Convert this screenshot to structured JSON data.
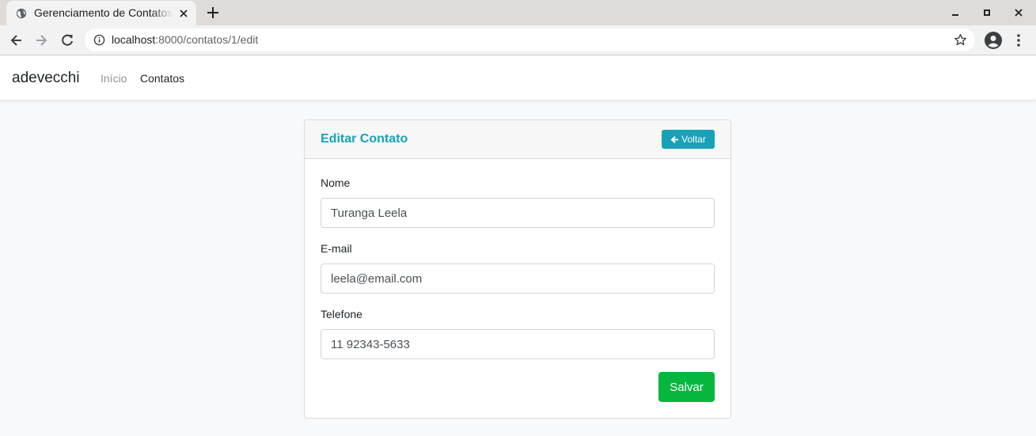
{
  "browser": {
    "tab_title": "Gerenciamento de Contatos",
    "url_host": "localhost",
    "url_path": ":8000/contatos/1/edit"
  },
  "navbar": {
    "brand": "adevecchi",
    "links": [
      {
        "label": "Início",
        "active": false
      },
      {
        "label": "Contatos",
        "active": true
      }
    ]
  },
  "card": {
    "title": "Editar Contato",
    "back_label": "Voltar",
    "fields": {
      "nome": {
        "label": "Nome",
        "value": "Turanga Leela"
      },
      "email": {
        "label": "E-mail",
        "value": "leela@email.com"
      },
      "telefone": {
        "label": "Telefone",
        "value": "11 92343-5633"
      }
    },
    "save_label": "Salvar"
  },
  "colors": {
    "accent": "#17a2b8",
    "success": "#06b73f",
    "page_bg": "#f8f9fa"
  }
}
